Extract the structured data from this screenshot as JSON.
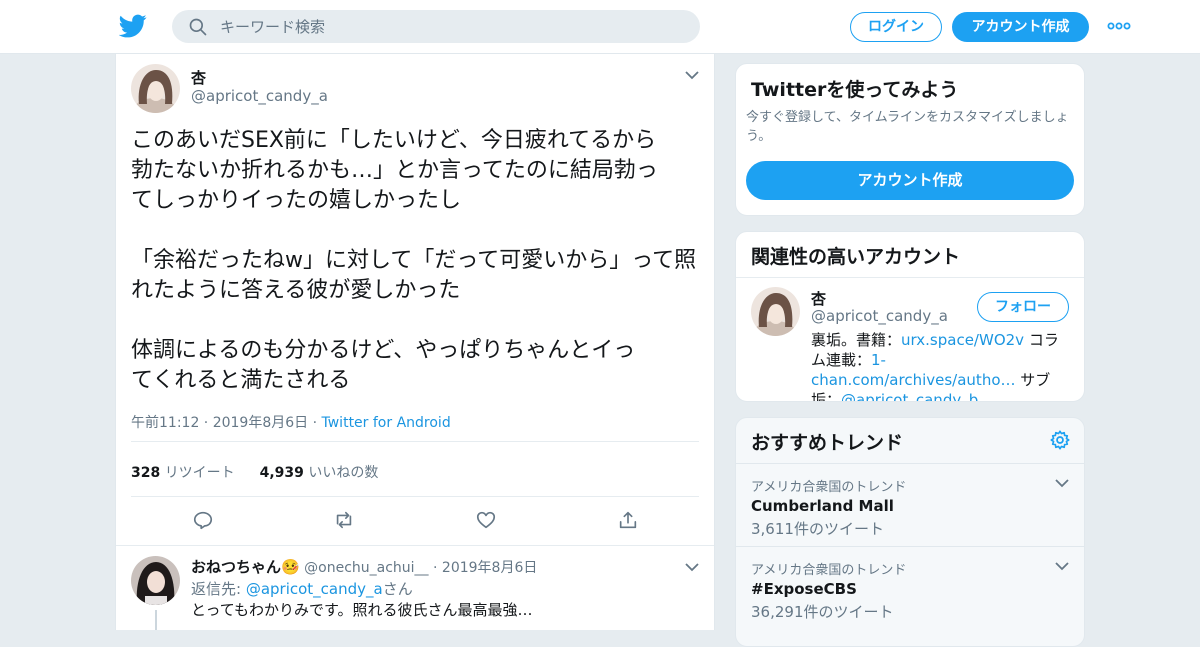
{
  "header": {
    "search_placeholder": "キーワード検索",
    "login_label": "ログイン",
    "signup_label": "アカウント作成",
    "icons": [
      "twitter-bird-icon",
      "search-icon",
      "more-dots-icon"
    ],
    "accent": "#1da1f2"
  },
  "tweet": {
    "name": "杏",
    "handle": "@apricot_candy_a",
    "text": "このあいだSEX前に「したいけど、今日疲れてるから\n勃たないか折れるかも…」とか言ってたのに結局勃っ\nてしっかりイったの嬉しかったし\n\n「余裕だったねw」に対して「だって可愛いから」って照\nれたように答える彼が愛しかった\n\n体調によるのも分かるけど、やっぱりちゃんとイっ\nてくれると満たされる",
    "timestamp": "午前11:12 · 2019年8月6日 ·",
    "source": "Twitter for Android",
    "retweets": "328",
    "retweets_label": "リツイート",
    "likes": "4,939",
    "likes_label": "いいねの数"
  },
  "reply": {
    "name": "おねつちゃん🤒",
    "handle": "@onechu_achui__",
    "date": "· 2019年8月6日",
    "reply_to_prefix": "返信先: ",
    "reply_to_handle": "@apricot_candy_a",
    "reply_to_suffix": "さん",
    "text": "とってもわかりみです。照れる彼氏さん最高最強…"
  },
  "sidebar": {
    "signup_card": {
      "title": "Twitterを使ってみよう",
      "desc": "今すぐ登録して、タイムラインをカスタマイズしましょう。",
      "button": "アカウント作成"
    },
    "related": {
      "title": "関連性の高いアカウント",
      "name": "杏",
      "handle": "@apricot_candy_a",
      "follow": "フォロー",
      "bio_1": "裏垢。書籍：",
      "bio_link1": "urx.space/WO2v",
      "bio_2": " コラム連載：",
      "bio_link2": "1-chan.com/archives/autho…",
      "bio_3": " サブ垢：",
      "bio_link3": "@apricot_candy_b"
    },
    "trends": {
      "title": "おすすめトレンド",
      "items": [
        {
          "location": "アメリカ合衆国のトレンド",
          "name": "Cumberland Mall",
          "count": "3,611件のツイート"
        },
        {
          "location": "アメリカ合衆国のトレンド",
          "name": "#ExposeCBS",
          "count": "36,291件のツイート"
        }
      ]
    }
  }
}
